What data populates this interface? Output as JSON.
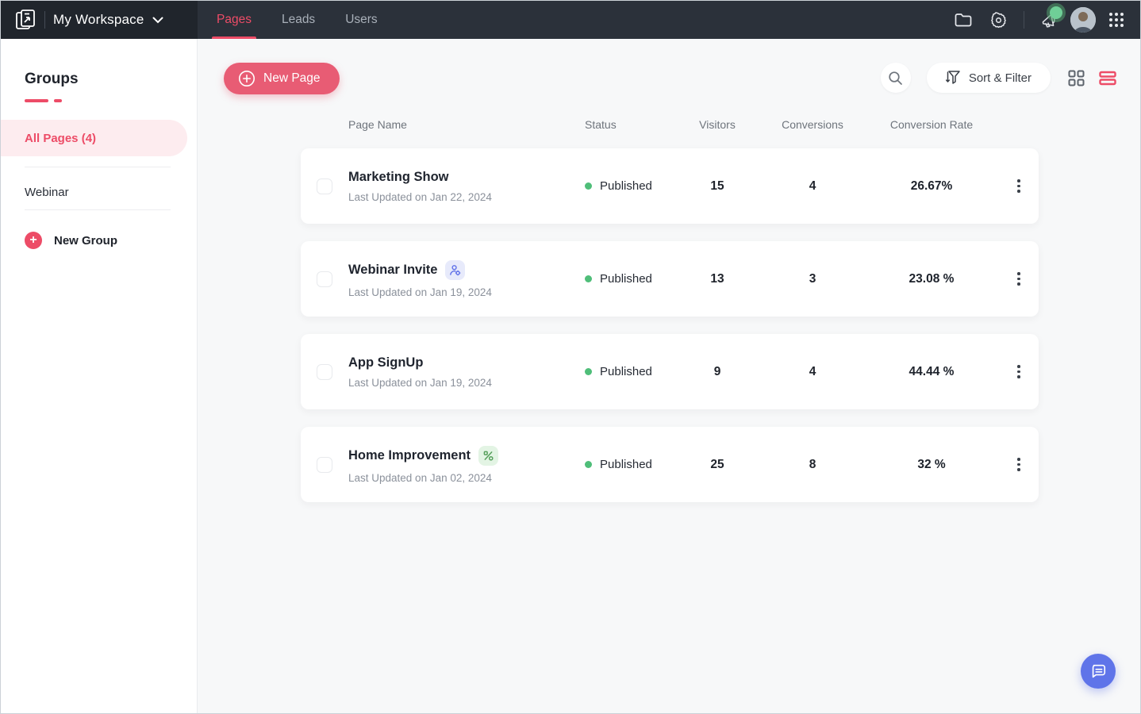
{
  "topbar": {
    "workspace_name": "My Workspace",
    "tabs": [
      {
        "label": "Pages",
        "active": true
      },
      {
        "label": "Leads",
        "active": false
      },
      {
        "label": "Users",
        "active": false
      }
    ],
    "icons": [
      "logo",
      "chevron-down",
      "folder",
      "settings-gear",
      "announcement-megaphone",
      "user-avatar",
      "apps-grid"
    ],
    "announcement_has_badge": true
  },
  "sidebar": {
    "title": "Groups",
    "active_item": "All Pages (4)",
    "items": [
      {
        "label": "All Pages (4)",
        "active": true
      },
      {
        "label": "Webinar",
        "active": false
      }
    ],
    "new_group_label": "New Group"
  },
  "toolbar": {
    "new_page_label": "New Page",
    "sort_filter_label": "Sort & Filter",
    "view_mode": "list"
  },
  "table": {
    "headers": [
      "Page Name",
      "Status",
      "Visitors",
      "Conversions",
      "Conversion Rate"
    ],
    "rows": [
      {
        "name": "Marketing Show",
        "updated": "Last Updated on Jan 22, 2024",
        "status": "Published",
        "visitors": "15",
        "conversions": "4",
        "rate": "26.67%",
        "badge": ""
      },
      {
        "name": "Webinar Invite",
        "updated": "Last Updated on Jan 19, 2024",
        "status": "Published",
        "visitors": "13",
        "conversions": "3",
        "rate": "23.08 %",
        "badge": "user-settings"
      },
      {
        "name": "App SignUp",
        "updated": "Last Updated on Jan 19, 2024",
        "status": "Published",
        "visitors": "9",
        "conversions": "4",
        "rate": "44.44 %",
        "badge": ""
      },
      {
        "name": "Home Improvement",
        "updated": "Last Updated on Jan 02, 2024",
        "status": "Published",
        "visitors": "25",
        "conversions": "8",
        "rate": "32 %",
        "badge": "percent"
      }
    ]
  },
  "colors": {
    "accent_pink": "#ED4C67",
    "button_pink": "#E85C74",
    "active_item_bg": "#FDECEF",
    "status_green": "#4FBE79",
    "notification_green": "#6FCF97",
    "badge_blue_bg": "#E7EAFB",
    "badge_blue_icon": "#5E6FE8",
    "badge_green_bg": "#E3F4E4",
    "badge_green_icon": "#57A05C",
    "chat_fab_blue": "#5F74E9",
    "topbar_left_bg": "#20252C",
    "topbar_right_bg": "#2B313A"
  }
}
